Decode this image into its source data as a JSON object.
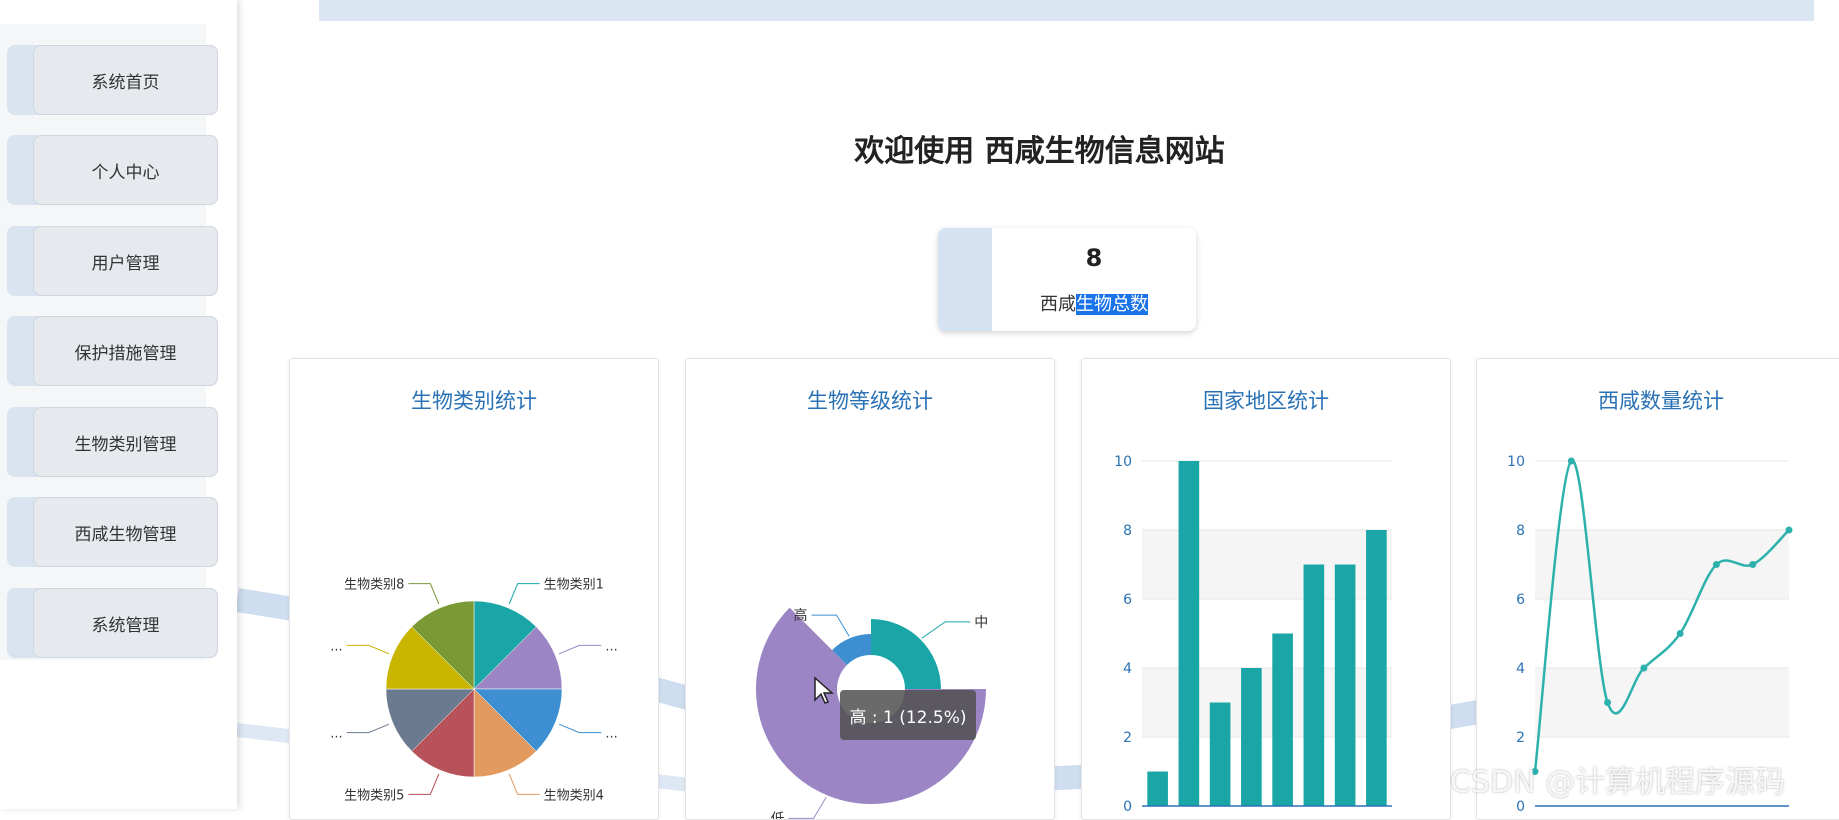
{
  "sidebar": {
    "items": [
      {
        "label": "系统首页"
      },
      {
        "label": "个人中心"
      },
      {
        "label": "用户管理"
      },
      {
        "label": "保护措施管理"
      },
      {
        "label": "生物类别管理"
      },
      {
        "label": "西咸生物管理"
      },
      {
        "label": "系统管理"
      }
    ]
  },
  "main": {
    "welcome": "欢迎使用 西咸生物信息网站",
    "stat": {
      "value": "8",
      "label_prefix": "西咸",
      "label_highlight": "生物总数"
    }
  },
  "panels": [
    {
      "title": "生物类别统计"
    },
    {
      "title": "生物等级统计"
    },
    {
      "title": "国家地区统计"
    },
    {
      "title": "西咸数量统计"
    }
  ],
  "tooltip": {
    "text": "高 : 1 (12.5%)"
  },
  "watermark": "CSDN @计算机程序源码",
  "colors": {
    "accent": "#2a72b5",
    "teal": "#1aa6a6"
  },
  "chart_data": [
    {
      "type": "pie",
      "title": "生物类别统计",
      "slices": [
        {
          "label": "生物类别1",
          "value": 1,
          "color": "#1aa6a6"
        },
        {
          "label": "...",
          "value": 1,
          "color": "#9c85c4"
        },
        {
          "label": "...",
          "value": 1,
          "color": "#3d8fd1"
        },
        {
          "label": "生物类别4",
          "value": 1,
          "color": "#e39a5f"
        },
        {
          "label": "生物类别5",
          "value": 1,
          "color": "#b8525a"
        },
        {
          "label": "...",
          "value": 1,
          "color": "#6b7a8f"
        },
        {
          "label": "...",
          "value": 1,
          "color": "#c9b400"
        },
        {
          "label": "生物类别8",
          "value": 1,
          "color": "#7a9a35"
        }
      ]
    },
    {
      "type": "pie",
      "title": "生物等级统计",
      "slices": [
        {
          "label": "中",
          "value": 2,
          "color": "#1aa6a6"
        },
        {
          "label": "低",
          "value": 5,
          "color": "#9c85c4"
        },
        {
          "label": "高",
          "value": 1,
          "color": "#3d8fd1"
        }
      ]
    },
    {
      "type": "bar",
      "title": "国家地区统计",
      "values": [
        1,
        10,
        3,
        4,
        5,
        7,
        7,
        8
      ],
      "ylim": [
        0,
        10
      ],
      "yticks": [
        "0",
        "2",
        "4",
        "6",
        "8",
        "10"
      ],
      "color": "#1aa6a6"
    },
    {
      "type": "line",
      "title": "西咸数量统计",
      "values": [
        1,
        10,
        3,
        4,
        5,
        7,
        7,
        8
      ],
      "ylim": [
        0,
        10
      ],
      "yticks": [
        "0",
        "2",
        "4",
        "6",
        "8",
        "10"
      ],
      "color": "#2db1ad"
    }
  ]
}
